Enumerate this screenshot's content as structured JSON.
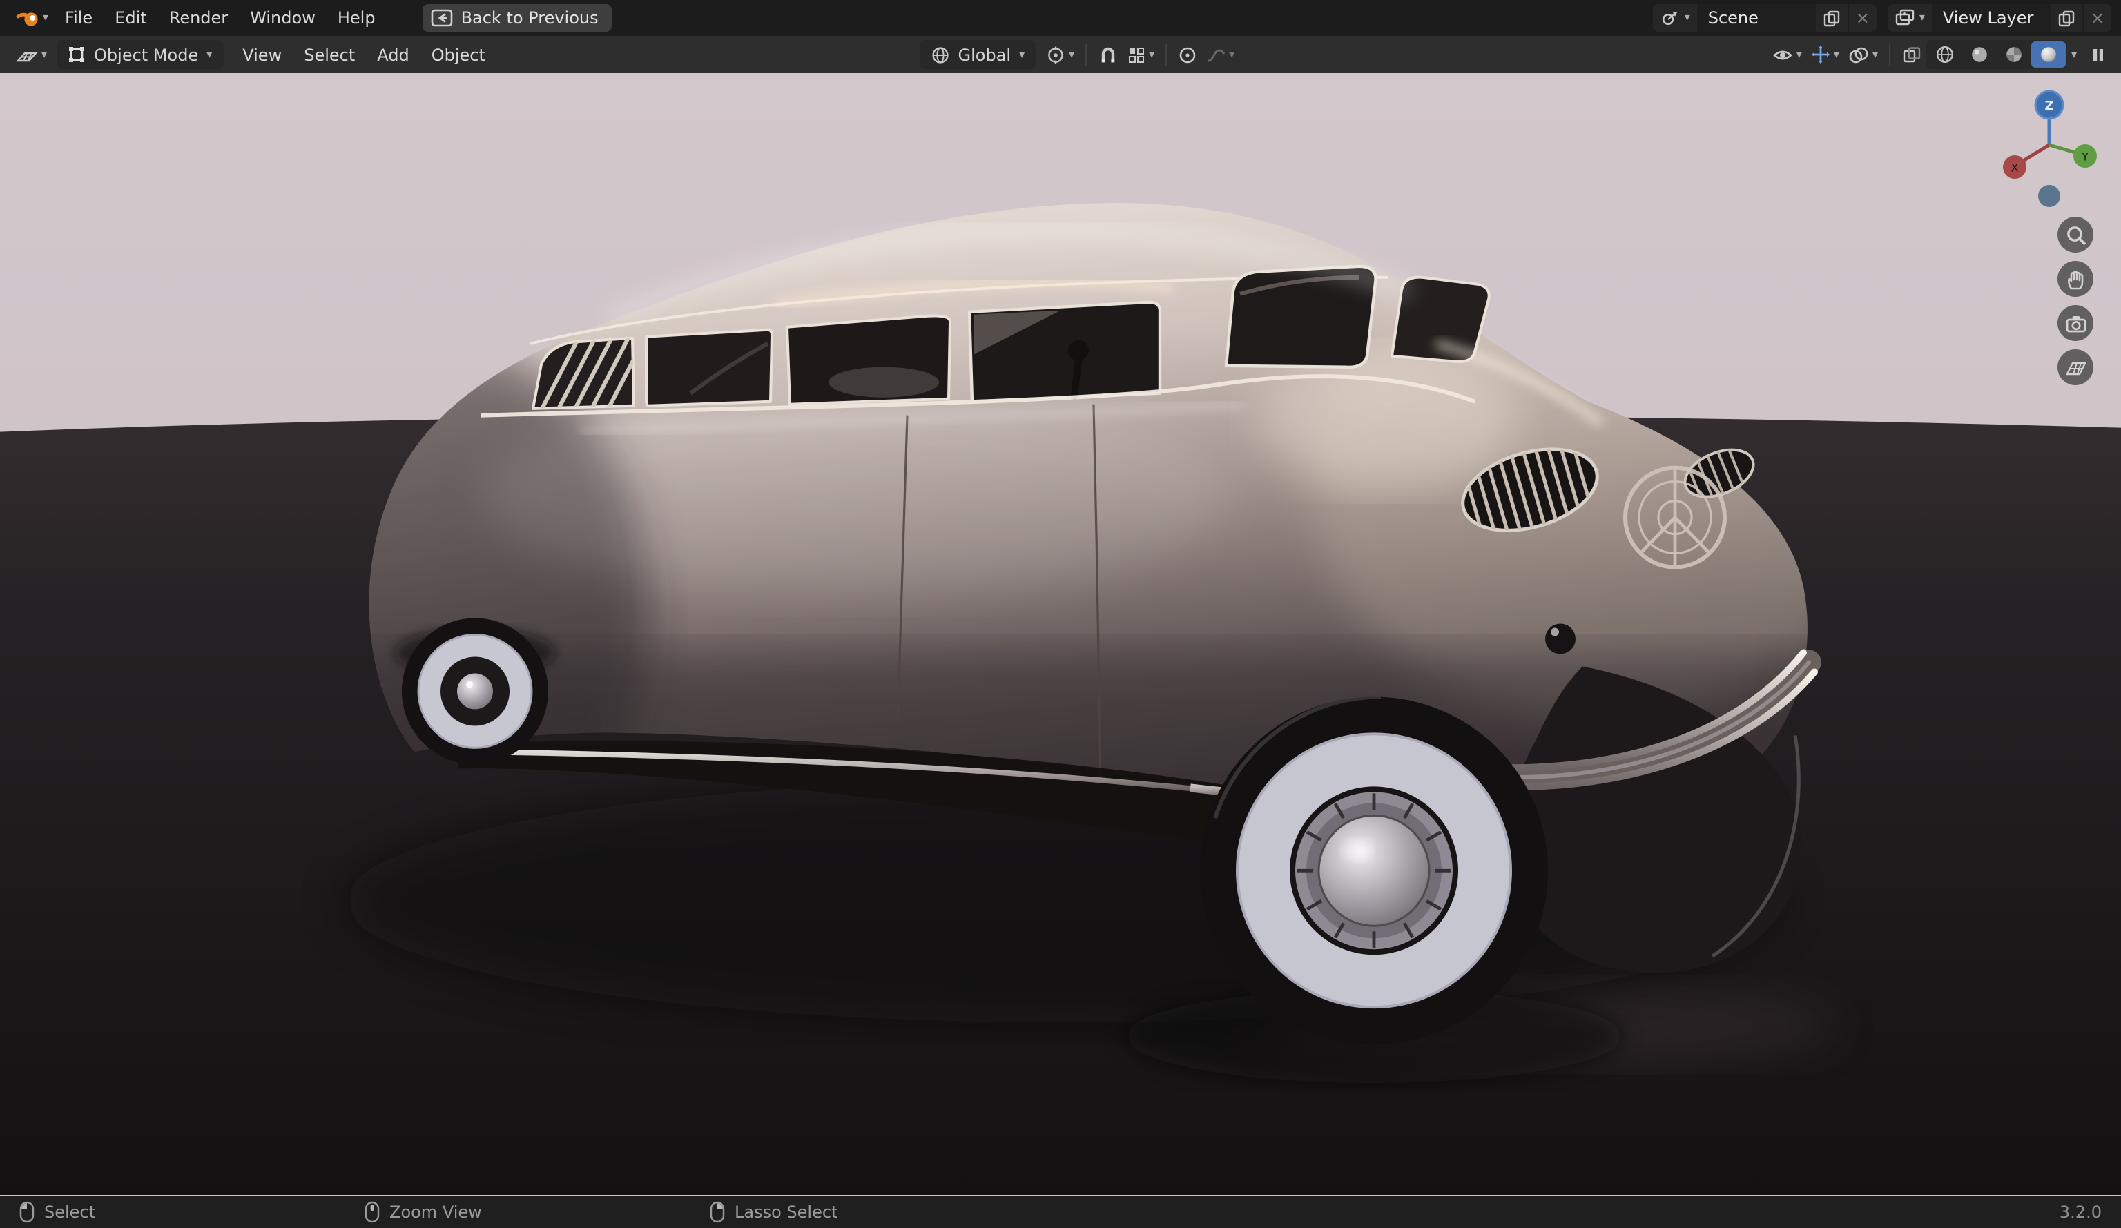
{
  "topbar": {
    "menus": [
      "File",
      "Edit",
      "Render",
      "Window",
      "Help"
    ],
    "back_button": "Back to Previous",
    "scene_field": "Scene",
    "view_layer_field": "View Layer"
  },
  "viewport_header": {
    "mode": "Object Mode",
    "menus": [
      "View",
      "Select",
      "Add",
      "Object"
    ],
    "orientation": "Global"
  },
  "gizmo": {
    "z": "Z",
    "x": "X",
    "y": "Y"
  },
  "status_bar": {
    "hint_select": "Select",
    "hint_zoom": "Zoom View",
    "hint_lasso": "Lasso Select",
    "version": "3.2.0"
  },
  "glyphs": {
    "caret": "▾",
    "close": "×"
  },
  "colors": {
    "accent_blue": "#4772b3",
    "topbar_bg": "#1c1c1c",
    "header_bg": "#2e2e2e",
    "viewport_sky": "#cdc2c7",
    "ground": "#262124"
  },
  "icon_names": [
    "blender-logo",
    "back-arrow",
    "scene-browse",
    "copy",
    "close",
    "view-layer",
    "editor-type",
    "object-mode",
    "globe",
    "pivot",
    "magnet",
    "snap",
    "proportional",
    "falloff",
    "eye",
    "gizmo-toggle",
    "overlays",
    "xray",
    "wireframe-shading",
    "solid-shading",
    "material-shading",
    "rendered-shading",
    "pause",
    "magnifier",
    "hand",
    "camera",
    "grid-ortho",
    "mouse-left",
    "mouse-middle",
    "mouse-right",
    "nav-gizmo"
  ]
}
